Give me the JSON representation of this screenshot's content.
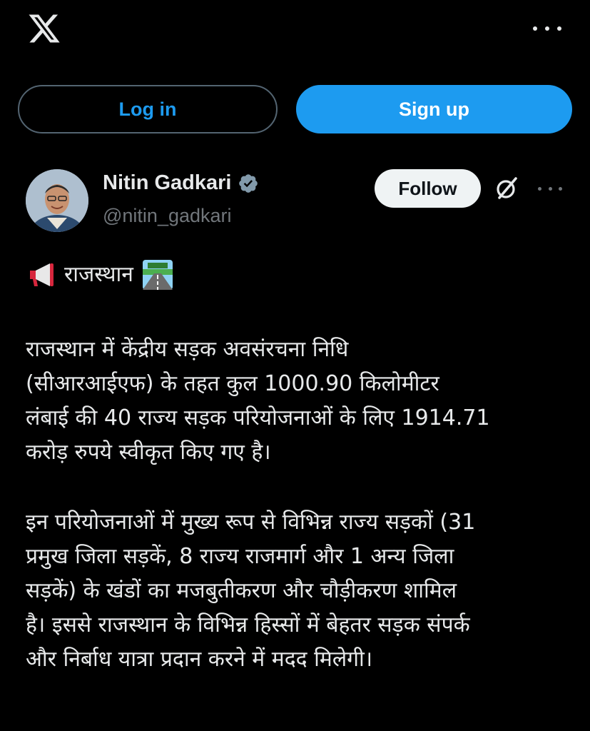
{
  "header": {
    "logo_icon": "x-logo-icon",
    "more_icon": "more-dots-icon"
  },
  "auth": {
    "login_label": "Log in",
    "signup_label": "Sign up"
  },
  "author": {
    "name": "Nitin Gadkari",
    "handle": "@nitin_gadkari",
    "verified_icon": "verified-badge-icon",
    "follow_label": "Follow",
    "grok_icon": "grok-icon",
    "more_icon": "more-dots-icon"
  },
  "tweet": {
    "headline": "राजस्थान",
    "headline_prefix_icon": "megaphone-icon",
    "headline_suffix_icon": "motorway-icon",
    "paragraph1": "राजस्थान में केंद्रीय सड़क अवसंरचना निधि\n(सीआरआईएफ) के तहत कुल 1000.90 किलोमीटर\nलंबाई की 40 राज्य सड़क परियोजनाओं के लिए 1914.71\nकरोड़ रुपये स्वीकृत किए गए है।",
    "paragraph2": "इन परियोजनाओं में मुख्य रूप से विभिन्न राज्य सड़कों (31\nप्रमुख जिला सड़कें, 8 राज्य राजमार्ग और 1 अन्य जिला\nसड़कें) के खंडों का मजबुतीकरण और चौड़ीकरण शामिल\nहै। इससे राजस्थान के विभिन्न हिस्सों में बेहतर सड़क संपर्क\nऔर निर्बाध यात्रा प्रदान करने में मदद मिलेगी।"
  },
  "colors": {
    "background": "#000000",
    "accent": "#1d9bf0",
    "text": "#e7e9ea",
    "secondary_text": "#71767b"
  }
}
